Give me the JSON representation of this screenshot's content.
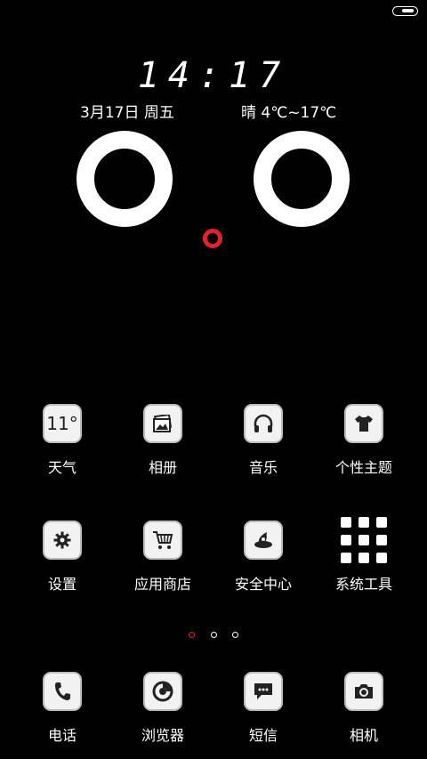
{
  "status_bar": {
    "battery_level": 0.5
  },
  "lockscreen": {
    "time": "14:17",
    "date": "3月17日 周五",
    "weather": "晴 4℃~17℃"
  },
  "apps_row1": [
    {
      "label": "天气",
      "tile_text": "11°",
      "icon": "weather-icon"
    },
    {
      "label": "相册",
      "icon": "gallery-icon"
    },
    {
      "label": "音乐",
      "icon": "headphones-icon"
    },
    {
      "label": "个性主题",
      "icon": "tshirt-icon"
    }
  ],
  "apps_row2": [
    {
      "label": "设置",
      "icon": "gear-icon"
    },
    {
      "label": "应用商店",
      "icon": "cart-icon"
    },
    {
      "label": "安全中心",
      "icon": "security-icon"
    },
    {
      "label": "系统工具",
      "icon": "folder-grid-icon"
    }
  ],
  "dock": [
    {
      "label": "电话",
      "icon": "phone-icon"
    },
    {
      "label": "浏览器",
      "icon": "browser-icon"
    },
    {
      "label": "短信",
      "icon": "message-icon"
    },
    {
      "label": "相机",
      "icon": "camera-icon"
    }
  ],
  "pager": {
    "pages": 3,
    "current": 1
  },
  "colors": {
    "accent": "#e0232b",
    "background": "#000000",
    "tile": "#f2f2f2"
  }
}
